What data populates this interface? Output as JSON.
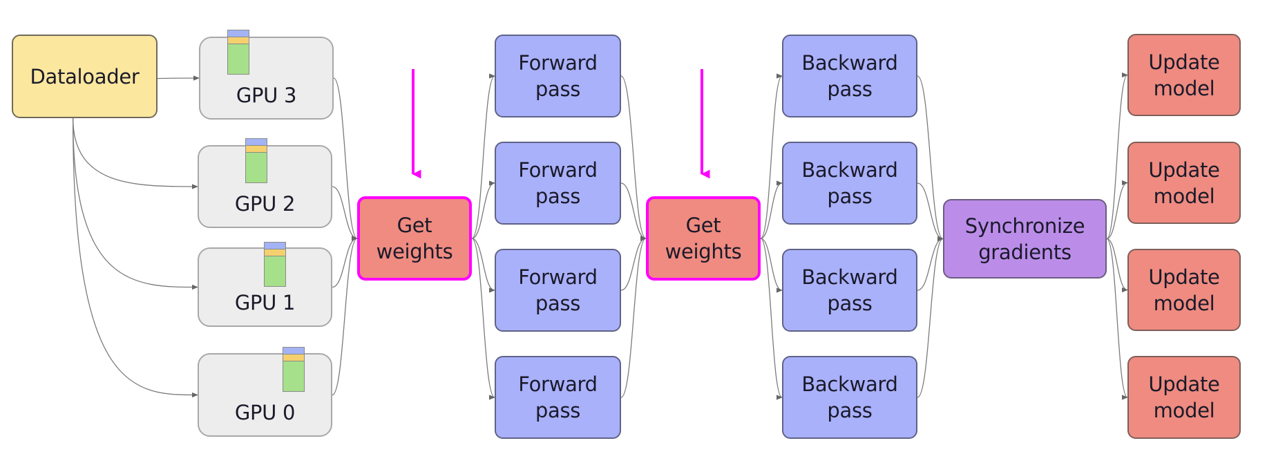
{
  "diagram": {
    "type": "data-parallel-training-flow",
    "highlight_color": "#ff00ff",
    "colors": {
      "dataloader": "#fce79e",
      "gpu": "#ededed",
      "get_weights": "#ef8b80",
      "forward_pass": "#aab1fb",
      "backward_pass": "#aab1fb",
      "synchronize": "#bb8de8",
      "update_model": "#ef8b80",
      "batch_blue": "#a4b3f5",
      "batch_yellow": "#f5d06e",
      "batch_green": "#a6e08a"
    },
    "nodes": {
      "dataloader": {
        "label": "Dataloader"
      },
      "gpus": [
        {
          "id": "gpu3",
          "label": "GPU 3"
        },
        {
          "id": "gpu2",
          "label": "GPU 2"
        },
        {
          "id": "gpu1",
          "label": "GPU 1"
        },
        {
          "id": "gpu0",
          "label": "GPU 0"
        }
      ],
      "get_weights": [
        {
          "id": "getw1",
          "label": "Get\nweights",
          "highlighted": true
        },
        {
          "id": "getw2",
          "label": "Get\nweights",
          "highlighted": true
        }
      ],
      "forward_pass": [
        {
          "label": "Forward\npass"
        },
        {
          "label": "Forward\npass"
        },
        {
          "label": "Forward\npass"
        },
        {
          "label": "Forward\npass"
        }
      ],
      "backward_pass": [
        {
          "label": "Backward\npass"
        },
        {
          "label": "Backward\npass"
        },
        {
          "label": "Backward\npass"
        },
        {
          "label": "Backward\npass"
        }
      ],
      "synchronize": {
        "label": "Synchronize\ngradients"
      },
      "update_model": [
        {
          "label": "Update\nmodel"
        },
        {
          "label": "Update\nmodel"
        },
        {
          "label": "Update\nmodel"
        },
        {
          "label": "Update\nmodel"
        }
      ]
    },
    "edges": [
      [
        "dataloader",
        "gpu3"
      ],
      [
        "dataloader",
        "gpu2"
      ],
      [
        "dataloader",
        "gpu1"
      ],
      [
        "dataloader",
        "gpu0"
      ],
      [
        "gpu3",
        "getw1"
      ],
      [
        "gpu2",
        "getw1"
      ],
      [
        "gpu1",
        "getw1"
      ],
      [
        "gpu0",
        "getw1"
      ],
      [
        "getw1",
        "fwd0"
      ],
      [
        "getw1",
        "fwd1"
      ],
      [
        "getw1",
        "fwd2"
      ],
      [
        "getw1",
        "fwd3"
      ],
      [
        "fwd0",
        "getw2"
      ],
      [
        "fwd1",
        "getw2"
      ],
      [
        "fwd2",
        "getw2"
      ],
      [
        "fwd3",
        "getw2"
      ],
      [
        "getw2",
        "bwd0"
      ],
      [
        "getw2",
        "bwd1"
      ],
      [
        "getw2",
        "bwd2"
      ],
      [
        "getw2",
        "bwd3"
      ],
      [
        "bwd0",
        "sync"
      ],
      [
        "bwd1",
        "sync"
      ],
      [
        "bwd2",
        "sync"
      ],
      [
        "bwd3",
        "sync"
      ],
      [
        "sync",
        "upd0"
      ],
      [
        "sync",
        "upd1"
      ],
      [
        "sync",
        "upd2"
      ],
      [
        "sync",
        "upd3"
      ]
    ],
    "highlight_arrows": [
      "getw1",
      "getw2"
    ]
  }
}
